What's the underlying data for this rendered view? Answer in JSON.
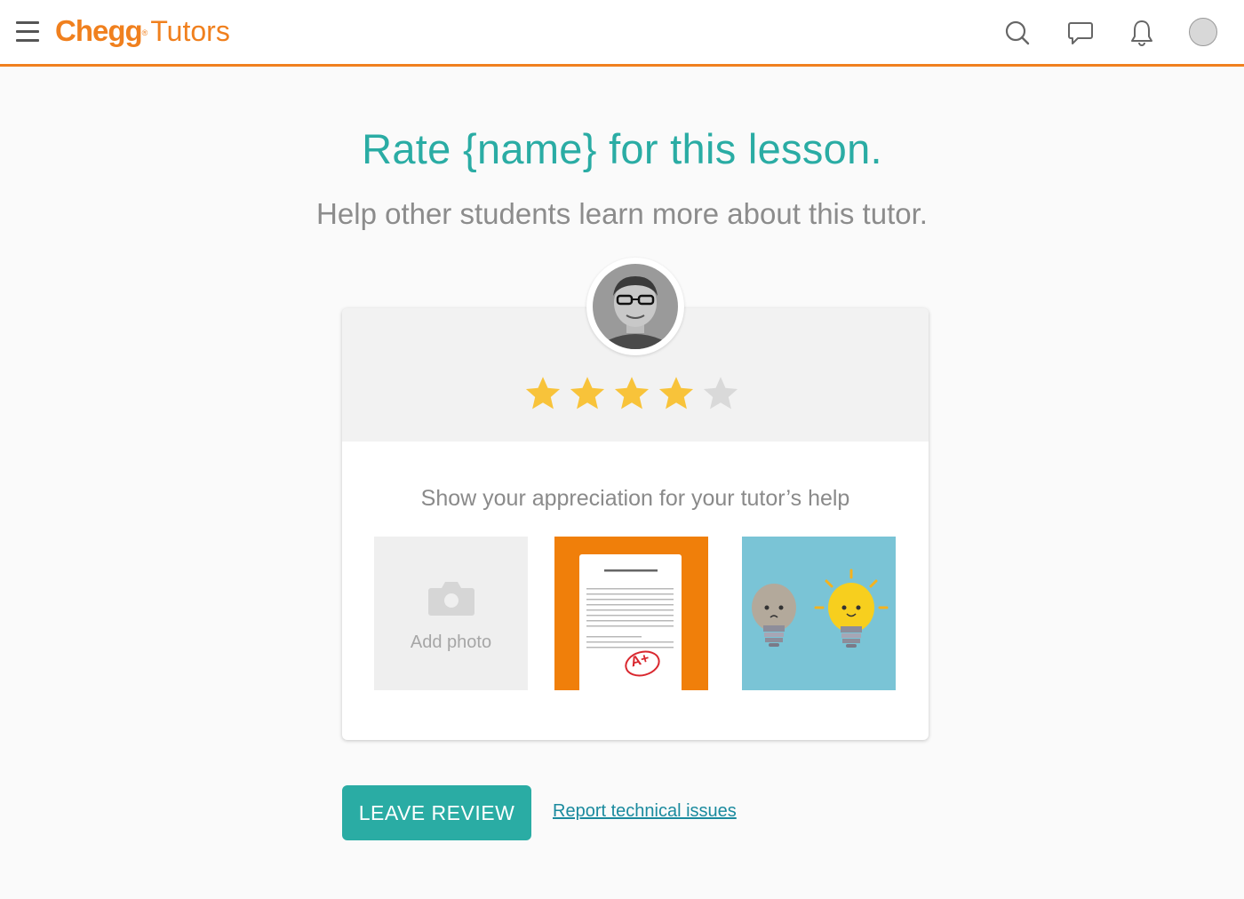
{
  "header": {
    "brand_name": "Chegg",
    "brand_mark": "®",
    "brand_product": "Tutors",
    "icons": [
      "menu-icon",
      "search-icon",
      "chat-icon",
      "bell-icon",
      "user-avatar"
    ]
  },
  "main": {
    "title": "Rate {name} for this lesson.",
    "subtitle": "Help other students learn more about this tutor."
  },
  "rating_card": {
    "rating": 4,
    "max_rating": 5,
    "appreciation_text": "Show your appreciation for your tutor’s help",
    "tiles": [
      {
        "kind": "add-photo",
        "label": "Add photo"
      },
      {
        "kind": "graded-paper",
        "badge": "A+"
      },
      {
        "kind": "lightbulbs"
      }
    ]
  },
  "actions": {
    "leave_review_label": "LEAVE REVIEW",
    "report_link": "Report technical issues"
  },
  "colors": {
    "brand": "#f0801e",
    "accent": "#2aaca4",
    "star_filled": "#f8c33a",
    "star_empty": "#d9d9d9"
  }
}
